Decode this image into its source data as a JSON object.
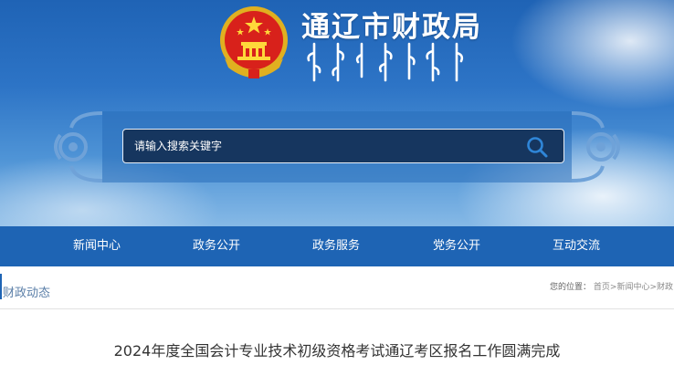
{
  "site": {
    "title": "通辽市财政局",
    "emblem_icon": "national-emblem-icon",
    "mongolian_script_icon": "mongolian-script-title"
  },
  "search": {
    "placeholder": "请输入搜索关键字",
    "button_icon": "search-icon"
  },
  "nav": {
    "items": [
      {
        "label": "新闻中心"
      },
      {
        "label": "政务公开"
      },
      {
        "label": "政务服务"
      },
      {
        "label": "党务公开"
      },
      {
        "label": "互动交流"
      }
    ]
  },
  "subbar": {
    "section_title": "财政动态",
    "location_label": "您的位置：",
    "breadcrumb": [
      "首页",
      "新闻中心",
      "财政"
    ],
    "separator": ">"
  },
  "article": {
    "title": "2024年度全国会计专业技术初级资格考试通辽考区报名工作圆满完成"
  },
  "colors": {
    "nav_blue": "#1e64b4",
    "search_box": "#16365f",
    "header_top": "#1f63b5"
  }
}
